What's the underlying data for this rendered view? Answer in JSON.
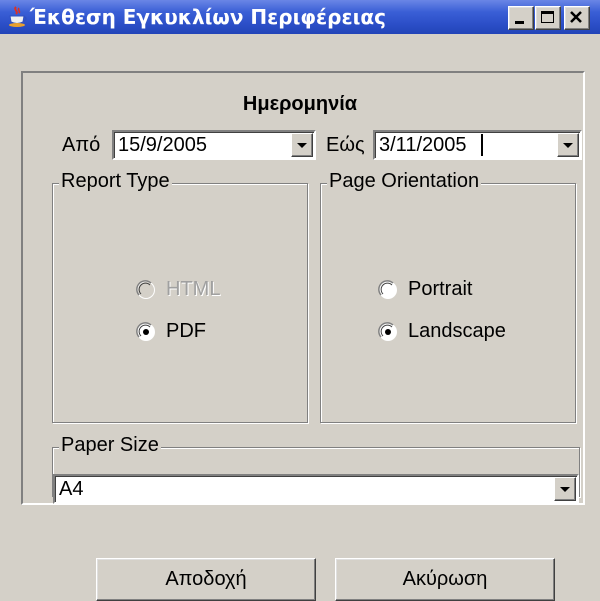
{
  "window": {
    "title": "Έκθεση Εγκυκλίων Περιφέρειας"
  },
  "date": {
    "heading": "Ημερομηνία",
    "from_label": "Από",
    "from_value": "15/9/2005",
    "to_label": "Εώς",
    "to_value": "3/11/2005"
  },
  "report_type": {
    "title": "Report Type",
    "options": [
      {
        "label": "HTML",
        "selected": false,
        "enabled": false
      },
      {
        "label": "PDF",
        "selected": true,
        "enabled": true
      }
    ]
  },
  "page_orientation": {
    "title": "Page Orientation",
    "options": [
      {
        "label": "Portrait",
        "selected": false,
        "enabled": true
      },
      {
        "label": "Landscape",
        "selected": true,
        "enabled": true
      }
    ]
  },
  "paper_size": {
    "title": "Paper Size",
    "value": "A4"
  },
  "buttons": {
    "accept": "Αποδοχή",
    "cancel": "Ακύρωση"
  },
  "icons": {
    "app": "java-coffee-cup-icon",
    "minimize": "minimize-icon",
    "maximize": "maximize-icon",
    "close": "close-icon",
    "dropdown": "chevron-down-icon"
  }
}
